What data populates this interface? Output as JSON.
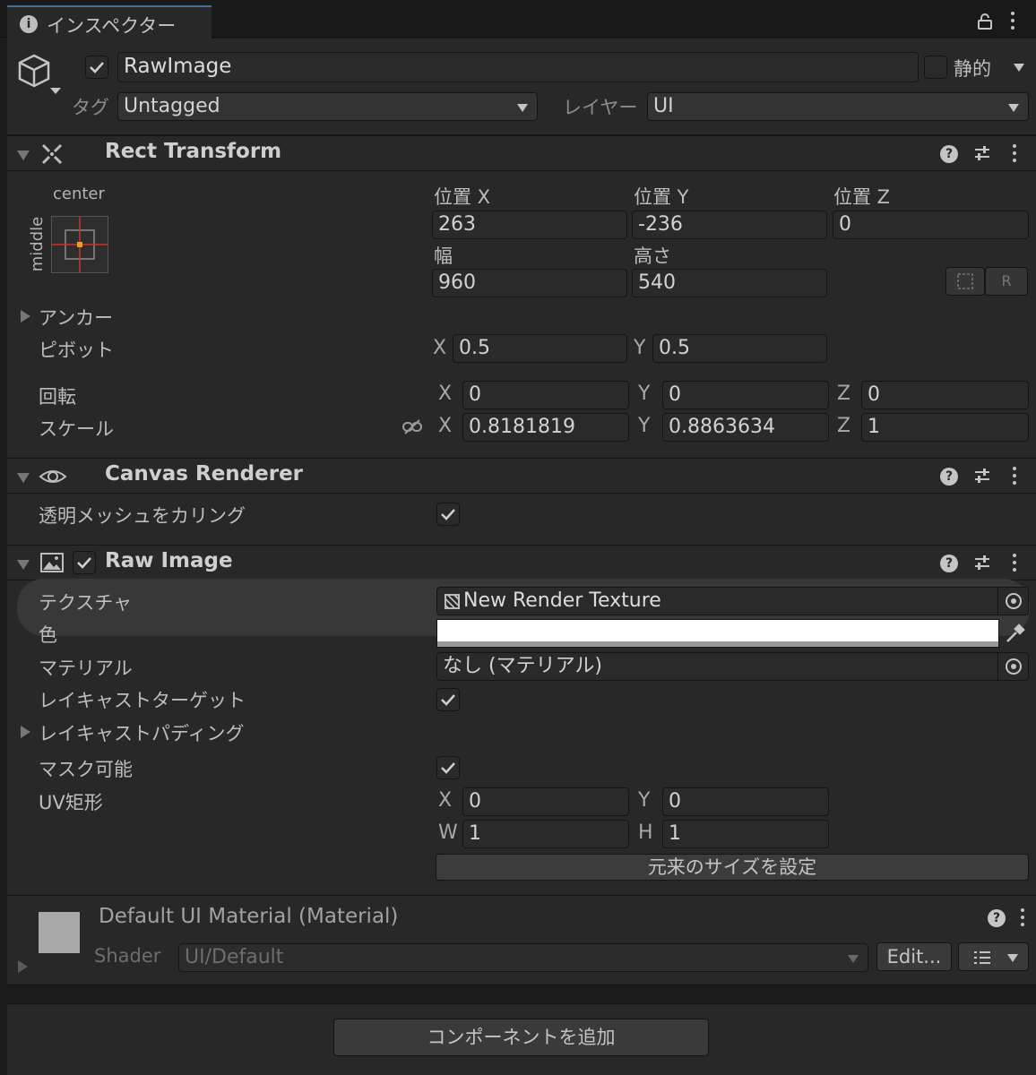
{
  "tab": {
    "label": "インスペクター"
  },
  "object": {
    "name": "RawImage",
    "static_label": "静的",
    "tag_label": "タグ",
    "tag_value": "Untagged",
    "layer_label": "レイヤー",
    "layer_value": "UI"
  },
  "rect_transform": {
    "title": "Rect Transform",
    "anchor_h": "center",
    "anchor_v": "middle",
    "pos_x_label": "位置 X",
    "pos_y_label": "位置 Y",
    "pos_z_label": "位置 Z",
    "pos_x": "263",
    "pos_y": "-236",
    "pos_z": "0",
    "width_label": "幅",
    "height_label": "高さ",
    "width": "960",
    "height": "540",
    "r_button": "R",
    "anchor_label": "アンカー",
    "pivot_label": "ピボット",
    "pivot_x": "0.5",
    "pivot_y": "0.5",
    "rotation_label": "回転",
    "rot_x": "0",
    "rot_y": "0",
    "rot_z": "0",
    "scale_label": "スケール",
    "scale_x": "0.8181819",
    "scale_y": "0.8863634",
    "scale_z": "1",
    "axis_x": "X",
    "axis_y": "Y",
    "axis_z": "Z"
  },
  "canvas_renderer": {
    "title": "Canvas Renderer",
    "cull_label": "透明メッシュをカリング"
  },
  "raw_image": {
    "title": "Raw Image",
    "texture_label": "テクスチャ",
    "texture_value": "New Render Texture",
    "color_label": "色",
    "color_value": "#ffffff",
    "material_label": "マテリアル",
    "material_value": "なし (マテリアル)",
    "raycast_target_label": "レイキャストターゲット",
    "raycast_padding_label": "レイキャストパディング",
    "maskable_label": "マスク可能",
    "uv_rect_label": "UV矩形",
    "uv_x": "0",
    "uv_y": "0",
    "uv_w": "1",
    "uv_h": "1",
    "axis_w": "W",
    "axis_h": "H",
    "native_size_button": "元来のサイズを設定"
  },
  "material": {
    "title": "Default UI Material (Material)",
    "shader_label": "Shader",
    "shader_value": "UI/Default",
    "edit_button": "Edit..."
  },
  "add_component_button": "コンポーネントを追加"
}
